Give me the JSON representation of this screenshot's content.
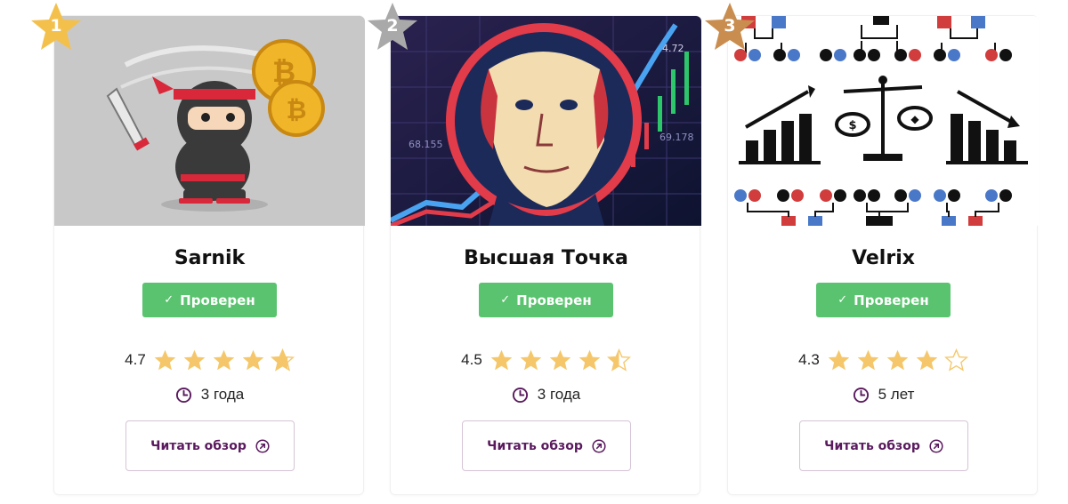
{
  "colors": {
    "verified_bg": "#5ac36f",
    "star_fill": "#f5c76a",
    "accent_purple": "#5a1a5e",
    "rank_gold": "#f3c04c",
    "rank_silver": "#a9a9a9",
    "rank_bronze": "#c98d4f"
  },
  "cards": [
    {
      "rank": "1",
      "rank_color": "gold",
      "image": "ninja-bitcoin-illustration",
      "name": "Sarnik",
      "verified_label": "Проверен",
      "rating": "4.7",
      "stars_filled": 4.7,
      "age": "3 года",
      "review_label": "Читать обзор"
    },
    {
      "rank": "2",
      "rank_color": "silver",
      "image": "franklin-portrait-chart",
      "name": "Высшая Точка",
      "verified_label": "Проверен",
      "rating": "4.5",
      "stars_filled": 4.5,
      "age": "3 года",
      "review_label": "Читать обзор"
    },
    {
      "rank": "3",
      "rank_color": "bronze",
      "image": "scales-charts-network",
      "name": "Velrix",
      "verified_label": "Проверен",
      "rating": "4.3",
      "stars_filled": 4.3,
      "age": "5 лет",
      "review_label": "Читать обзор"
    }
  ]
}
